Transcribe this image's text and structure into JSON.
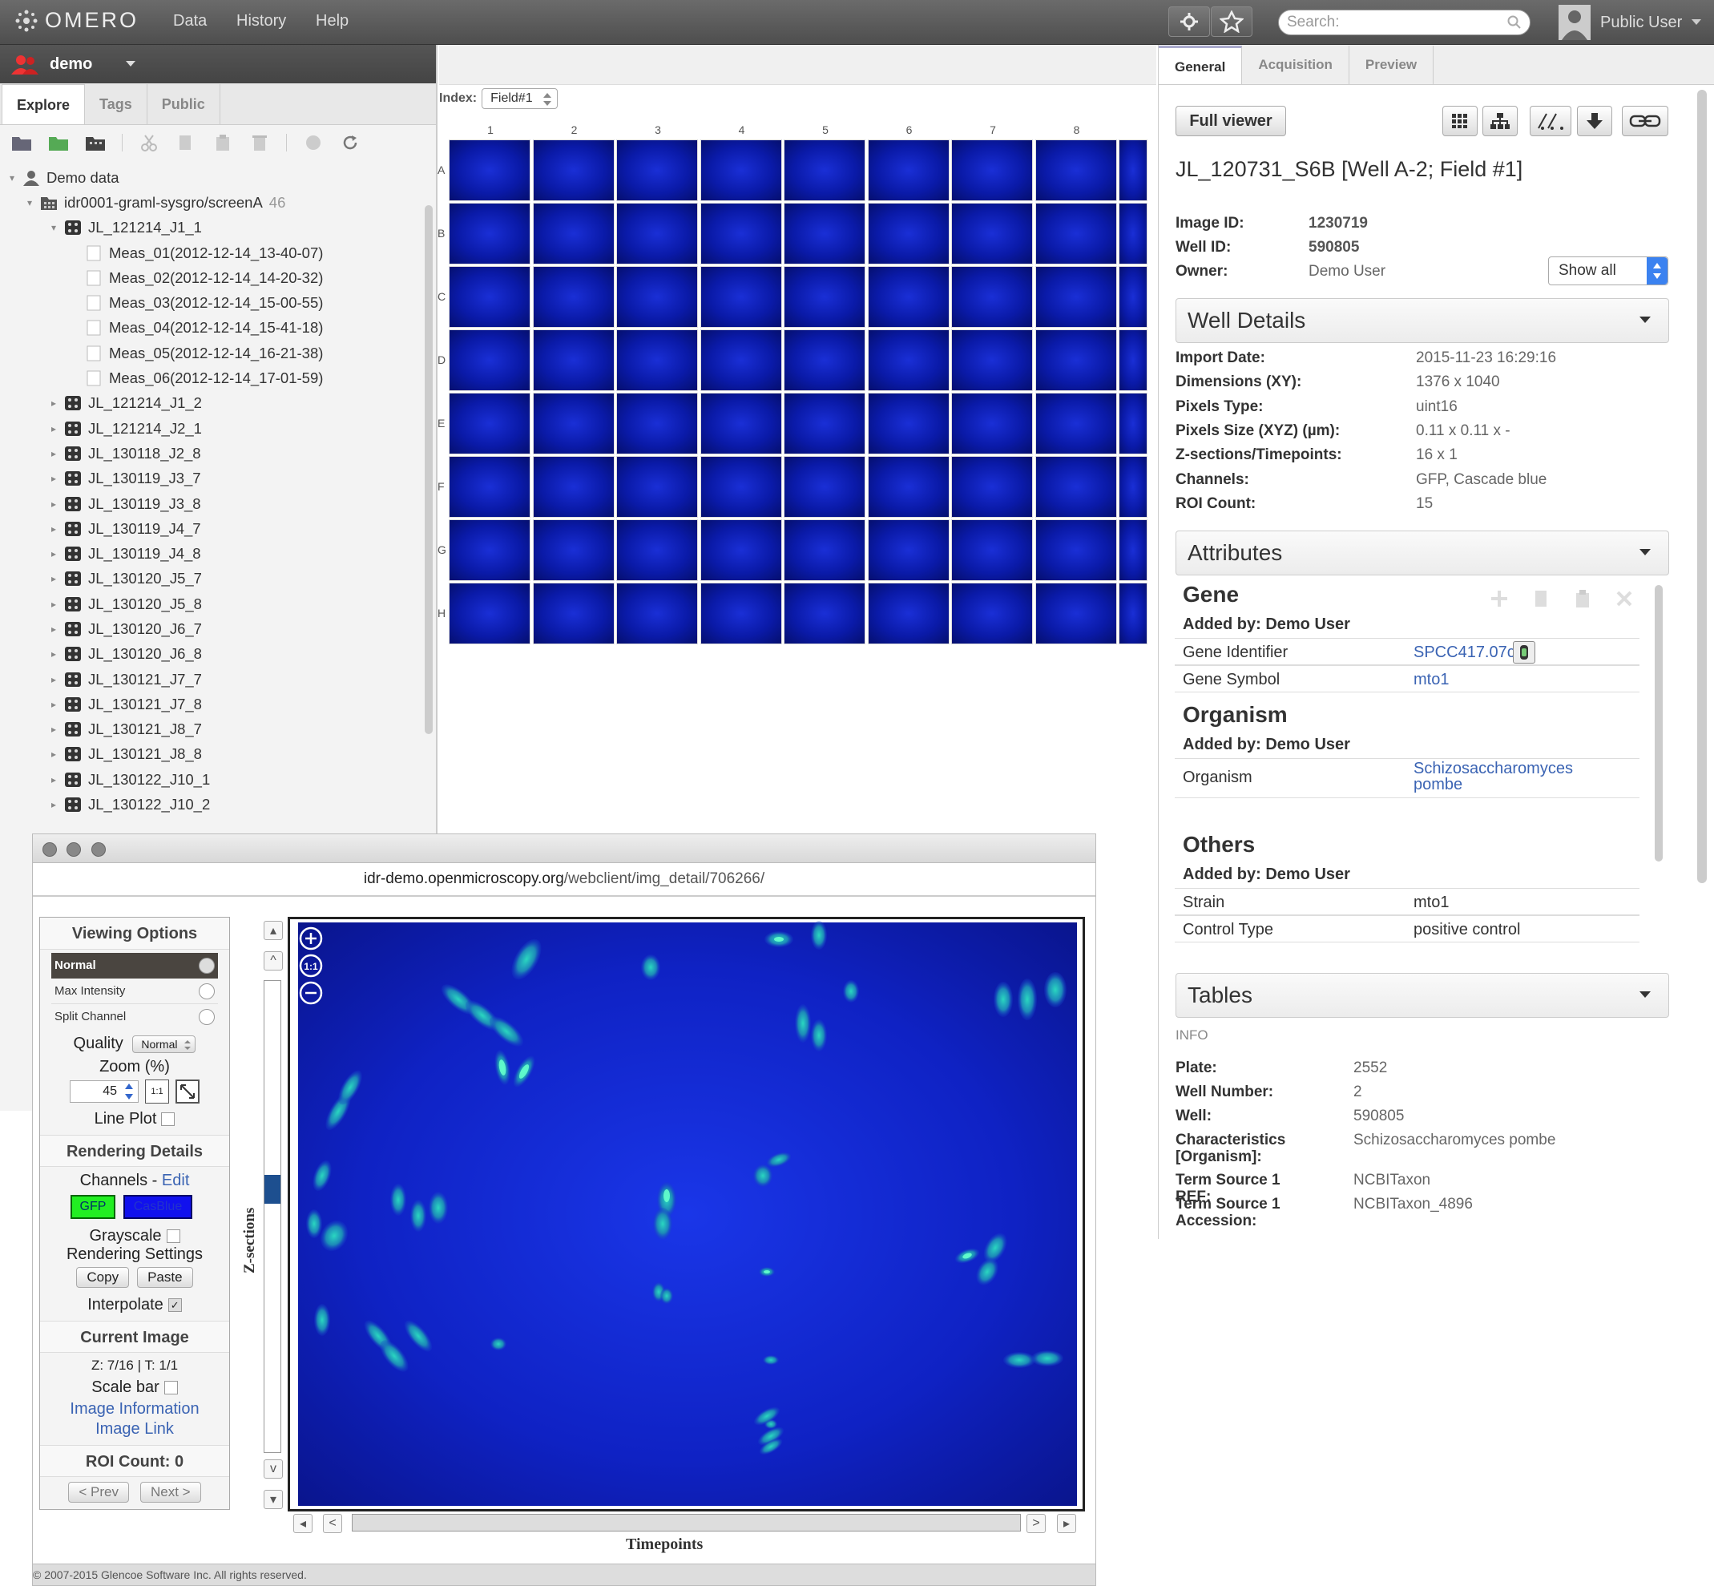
{
  "topbar": {
    "logo": "OMERO",
    "menu": [
      "Data",
      "History",
      "Help"
    ],
    "search_placeholder": "Search:",
    "user": "Public User"
  },
  "left": {
    "group": "demo",
    "tabs": [
      "Explore",
      "Tags",
      "Public"
    ],
    "tree": [
      {
        "label": "Demo data",
        "type": "user",
        "level": 0,
        "arrow": "▾"
      },
      {
        "label": "idr0001-graml-sysgro/screenA",
        "count": "46",
        "type": "screen",
        "level": 1,
        "arrow": "▾"
      },
      {
        "label": "JL_121214_J1_1",
        "type": "plate",
        "level": 2,
        "arrow": "▾"
      },
      {
        "label": "Meas_01(2012-12-14_13-40-07)",
        "type": "acq",
        "level": 3,
        "arrow": ""
      },
      {
        "label": "Meas_02(2012-12-14_14-20-32)",
        "type": "acq",
        "level": 3,
        "arrow": ""
      },
      {
        "label": "Meas_03(2012-12-14_15-00-55)",
        "type": "acq",
        "level": 3,
        "arrow": ""
      },
      {
        "label": "Meas_04(2012-12-14_15-41-18)",
        "type": "acq",
        "level": 3,
        "arrow": ""
      },
      {
        "label": "Meas_05(2012-12-14_16-21-38)",
        "type": "acq",
        "level": 3,
        "arrow": ""
      },
      {
        "label": "Meas_06(2012-12-14_17-01-59)",
        "type": "acq",
        "level": 3,
        "arrow": ""
      },
      {
        "label": "JL_121214_J1_2",
        "type": "plate",
        "level": 2,
        "arrow": "▸"
      },
      {
        "label": "JL_121214_J2_1",
        "type": "plate",
        "level": 2,
        "arrow": "▸"
      },
      {
        "label": "JL_130118_J2_8",
        "type": "plate",
        "level": 2,
        "arrow": "▸"
      },
      {
        "label": "JL_130119_J3_7",
        "type": "plate",
        "level": 2,
        "arrow": "▸"
      },
      {
        "label": "JL_130119_J3_8",
        "type": "plate",
        "level": 2,
        "arrow": "▸"
      },
      {
        "label": "JL_130119_J4_7",
        "type": "plate",
        "level": 2,
        "arrow": "▸"
      },
      {
        "label": "JL_130119_J4_8",
        "type": "plate",
        "level": 2,
        "arrow": "▸"
      },
      {
        "label": "JL_130120_J5_7",
        "type": "plate",
        "level": 2,
        "arrow": "▸"
      },
      {
        "label": "JL_130120_J5_8",
        "type": "plate",
        "level": 2,
        "arrow": "▸"
      },
      {
        "label": "JL_130120_J6_7",
        "type": "plate",
        "level": 2,
        "arrow": "▸"
      },
      {
        "label": "JL_130120_J6_8",
        "type": "plate",
        "level": 2,
        "arrow": "▸"
      },
      {
        "label": "JL_130121_J7_7",
        "type": "plate",
        "level": 2,
        "arrow": "▸"
      },
      {
        "label": "JL_130121_J7_8",
        "type": "plate",
        "level": 2,
        "arrow": "▸"
      },
      {
        "label": "JL_130121_J8_7",
        "type": "plate",
        "level": 2,
        "arrow": "▸"
      },
      {
        "label": "JL_130121_J8_8",
        "type": "plate",
        "level": 2,
        "arrow": "▸"
      },
      {
        "label": "JL_130122_J10_1",
        "type": "plate",
        "level": 2,
        "arrow": "▸"
      },
      {
        "label": "JL_130122_J10_2",
        "type": "plate",
        "level": 2,
        "arrow": "▸"
      }
    ]
  },
  "center": {
    "index_label": "Index:",
    "index_value": "Field#1",
    "columns": [
      "1",
      "2",
      "3",
      "4",
      "5",
      "6",
      "7",
      "8"
    ],
    "rows": [
      "A",
      "B",
      "C",
      "D",
      "E",
      "F",
      "G",
      "H"
    ]
  },
  "right": {
    "tabs": [
      "General",
      "Acquisition",
      "Preview"
    ],
    "full_viewer": "Full viewer",
    "title": "JL_120731_S6B [Well A-2; Field #1]",
    "image_id_label": "Image ID:",
    "image_id": "1230719",
    "well_id_label": "Well ID:",
    "well_id": "590805",
    "owner_label": "Owner:",
    "owner": "Demo User",
    "show_all": "Show all",
    "well_details_title": "Well Details",
    "well_details": [
      {
        "k": "Import Date:",
        "v": "2015-11-23 16:29:16"
      },
      {
        "k": "Dimensions (XY):",
        "v": "1376 x 1040"
      },
      {
        "k": "Pixels Type:",
        "v": "uint16"
      },
      {
        "k": "Pixels Size (XYZ) (µm):",
        "v": "0.11 x 0.11 x -"
      },
      {
        "k": "Z-sections/Timepoints:",
        "v": "16 x 1"
      },
      {
        "k": "Channels:",
        "v": "GFP, Cascade blue"
      },
      {
        "k": "ROI Count:",
        "v": "15"
      }
    ],
    "attributes_title": "Attributes",
    "gene": {
      "title": "Gene",
      "by": "Added by: Demo User",
      "rows": [
        {
          "k": "Gene Identifier",
          "v": "SPCC417.07c"
        },
        {
          "k": "Gene Symbol",
          "v": "mto1"
        }
      ]
    },
    "organism": {
      "title": "Organism",
      "by": "Added by: Demo User",
      "rows": [
        {
          "k": "Organism",
          "v": "Schizosaccharomyces pombe"
        }
      ]
    },
    "others": {
      "title": "Others",
      "by": "Added by: Demo User",
      "rows": [
        {
          "k": "Strain",
          "v": "mto1"
        },
        {
          "k": "Control Type",
          "v": "positive control"
        }
      ]
    },
    "tables_title": "Tables",
    "info_label": "INFO",
    "info": [
      {
        "k": "Plate:",
        "v": "2552"
      },
      {
        "k": "Well Number:",
        "v": "2"
      },
      {
        "k": "Well:",
        "v": "590805"
      },
      {
        "k": "Characteristics [Organism]:",
        "v": "Schizosaccharomyces pombe"
      },
      {
        "k": "Term Source 1 REF:",
        "v": "NCBITaxon"
      },
      {
        "k": "Term Source 1 Accession:",
        "v": "NCBITaxon_4896"
      }
    ]
  },
  "viewer": {
    "url_domain": "idr-demo.openmicroscopy.org",
    "url_path": "/webclient/img_detail/706266/",
    "viewing_options": "Viewing Options",
    "modes": [
      "Normal",
      "Max Intensity",
      "Split Channel"
    ],
    "quality_label": "Quality",
    "quality_value": "Normal",
    "zoom_label": "Zoom (%)",
    "zoom_value": "45",
    "zoom_fit": "1:1",
    "line_plot": "Line Plot",
    "rendering_details": "Rendering Details",
    "channels_label": "Channels - ",
    "channels_edit": "Edit",
    "channel1": "GFP",
    "channel2": "CasBlue",
    "grayscale": "Grayscale",
    "rendering_settings": "Rendering Settings",
    "copy": "Copy",
    "paste": "Paste",
    "interpolate": "Interpolate",
    "current_image": "Current Image",
    "zt": "Z: 7/16 | T: 1/1",
    "scale_bar": "Scale bar",
    "image_information": "Image Information",
    "image_link": "Image Link",
    "roi_count": "ROI Count: 0",
    "prev": "< Prev",
    "next": "Next >",
    "z_label": "Z-sections",
    "t_label": "Timepoints",
    "z_fraction": 0.4375,
    "footer": "© 2007-2015 Glencoe Software Inc. All rights reserved."
  },
  "colors": {
    "gfp": "#22ee22",
    "casblue": "#1111ee",
    "link": "#3a63b3"
  }
}
